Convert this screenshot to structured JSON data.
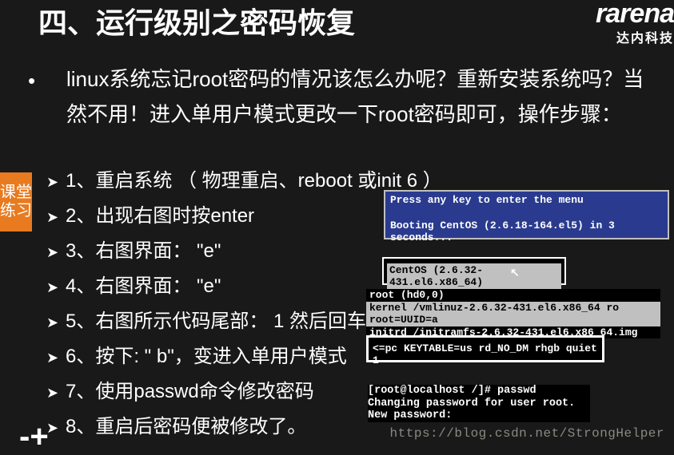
{
  "logo": {
    "main": "rarena",
    "sub": "达内科技"
  },
  "title": "四、运行级别之密码恢复",
  "intro": "linux系统忘记root密码的情况该怎么办呢？重新安装系统吗？当然不用！进入单用户模式更改一下root密码即可，操作步骤：",
  "steps": [
    "1、重启系统 （ 物理重启、reboot 或init 6 ）",
    "2、出现右图时按enter",
    "3、右图界面： \"e\"",
    "4、右图界面： \"e\"",
    "5、右图所示代码尾部： 1 然后回车",
    "6、按下: \" b\"，变进入单用户模式",
    "7、使用passwd命令修改密码",
    "8、重启后密码便被修改了。"
  ],
  "sideTab": "课堂练习",
  "boot": {
    "line1": "Press any key to enter the menu",
    "line2": "Booting CentOS (2.6.18-164.el5) in 3 seconds..."
  },
  "centos": "CentOS (2.6.32-431.el6.x86_64)",
  "kernel": {
    "l1": "root (hd0,0)",
    "l2": "kernel /vmlinuz-2.6.32-431.el6.x86_64 ro root=UUID=a",
    "l3": "initrd /initramfs-2.6.32-431.el6.x86_64.img"
  },
  "cmdline": "<=pc KEYTABLE=us rd_NO_DM rhgb quiet 1",
  "passwd": {
    "l1": "[root@localhost /]# passwd",
    "l2": "Changing password for user root.",
    "l3": "New password:"
  },
  "watermark": "https://blog.csdn.net/StrongHelper",
  "decor": "-+"
}
